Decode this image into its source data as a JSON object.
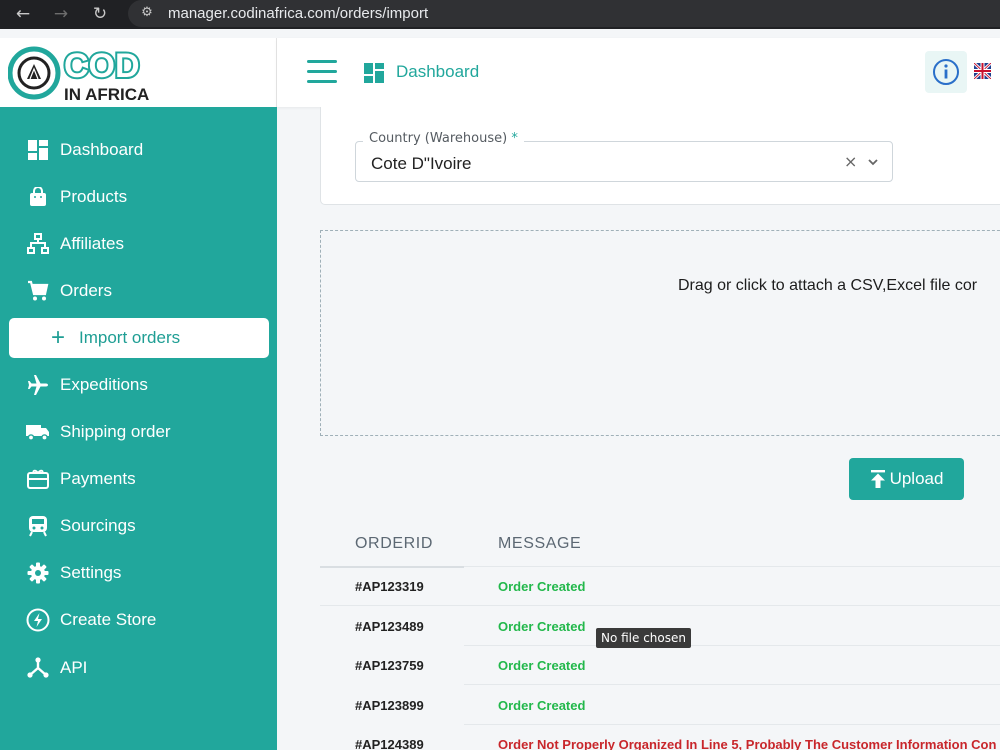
{
  "browser": {
    "url": "manager.codinafrica.com/orders/import"
  },
  "logo": {
    "line1": "COD",
    "line2": "IN AFRICA"
  },
  "sidebar": {
    "items": [
      {
        "label": "Dashboard",
        "icon": "dashboard-icon"
      },
      {
        "label": "Products",
        "icon": "shopping-bag-icon"
      },
      {
        "label": "Affiliates",
        "icon": "sitemap-icon"
      },
      {
        "label": "Orders",
        "icon": "cart-icon"
      },
      {
        "label": "Import orders",
        "icon": "plus-icon",
        "active": true
      },
      {
        "label": "Expeditions",
        "icon": "airplane-icon"
      },
      {
        "label": "Shipping order",
        "icon": "truck-icon"
      },
      {
        "label": "Payments",
        "icon": "gift-card-icon"
      },
      {
        "label": "Sourcings",
        "icon": "train-icon"
      },
      {
        "label": "Settings",
        "icon": "gear-icon"
      },
      {
        "label": "Create Store",
        "icon": "store-circle-icon"
      },
      {
        "label": "API",
        "icon": "api-icon"
      }
    ]
  },
  "topbar": {
    "breadcrumb": "Dashboard"
  },
  "country_select": {
    "label": "Country (Warehouse)",
    "required_mark": "*",
    "value": "Cote D\"Ivoire",
    "clear": "×"
  },
  "dropzone": {
    "text": "Drag or click to attach a CSV,Excel file cor"
  },
  "upload": {
    "label": "Upload"
  },
  "table": {
    "headers": [
      "ORDERID",
      "MESSAGE"
    ],
    "rows": [
      {
        "id": "#AP123319",
        "message": "Order Created",
        "status": "ok"
      },
      {
        "id": "#AP123489",
        "message": "Order Created",
        "status": "ok"
      },
      {
        "id": "#AP123759",
        "message": "Order Created",
        "status": "ok"
      },
      {
        "id": "#AP123899",
        "message": "Order Created",
        "status": "ok"
      },
      {
        "id": "#AP124389",
        "message": "Order Not Properly Organized In Line 5, Probably The Customer Information Con",
        "status": "error"
      }
    ]
  },
  "tooltip": {
    "text": "No file chosen"
  },
  "colors": {
    "accent": "#21a79c",
    "success": "#22b84b",
    "error": "#c8262b"
  }
}
